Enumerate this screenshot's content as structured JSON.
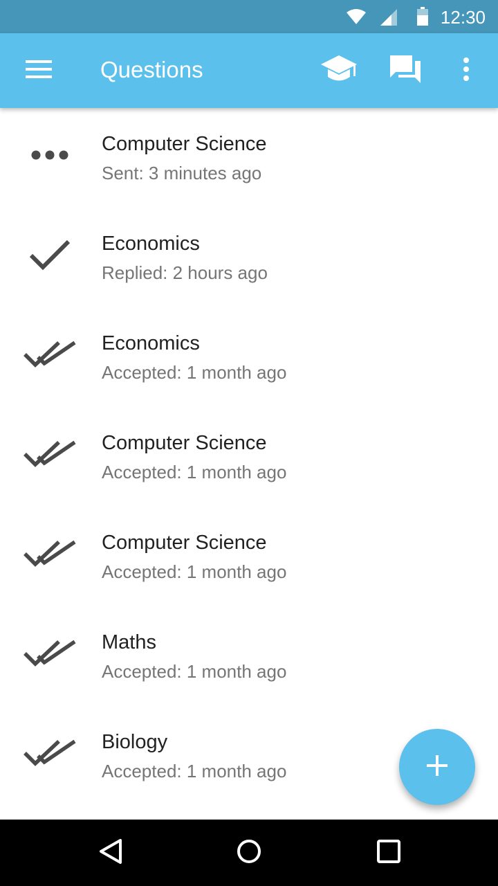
{
  "status_bar": {
    "time": "12:30",
    "icons": [
      "wifi-icon",
      "signal-icon",
      "battery-icon"
    ]
  },
  "app_bar": {
    "title": "Questions",
    "icons": [
      "menu-icon",
      "graduation-cap-icon",
      "forum-icon",
      "more-vert-icon"
    ],
    "color": "#5bc0eb"
  },
  "questions": [
    {
      "subject": "Computer Science",
      "status": "Sent: 3 minutes ago",
      "icon": "pending-dots-icon"
    },
    {
      "subject": "Economics",
      "status": "Replied: 2 hours ago",
      "icon": "check-icon"
    },
    {
      "subject": "Economics",
      "status": "Accepted: 1 month ago",
      "icon": "double-check-icon"
    },
    {
      "subject": "Computer Science",
      "status": "Accepted: 1 month ago",
      "icon": "double-check-icon"
    },
    {
      "subject": "Computer Science",
      "status": "Accepted: 1 month ago",
      "icon": "double-check-icon"
    },
    {
      "subject": "Maths",
      "status": "Accepted: 1 month ago",
      "icon": "double-check-icon"
    },
    {
      "subject": "Biology",
      "status": "Accepted: 1 month ago",
      "icon": "double-check-icon"
    }
  ],
  "fab": {
    "icon": "plus-icon"
  },
  "nav_bar": {
    "icons": [
      "back-icon",
      "home-icon",
      "recents-icon"
    ]
  }
}
